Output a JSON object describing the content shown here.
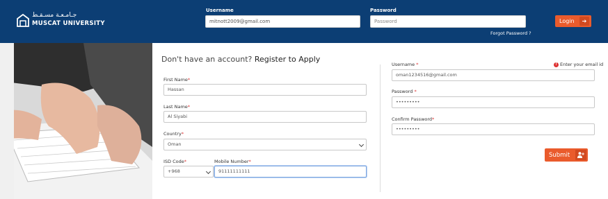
{
  "header": {
    "logo_arabic": "جـامـعـة مسـقـط",
    "logo_text": "MUSCAT UNIVERSITY",
    "username_label": "Username",
    "username_value": "mitnott2009@gmail.com",
    "password_label": "Password",
    "password_placeholder": "Password",
    "login_label": "Login",
    "forgot_label": "Forgot Password ?"
  },
  "register": {
    "heading_prefix": "Don't have an account?",
    "heading_strong": "Register to Apply",
    "first_name_label": "First Name",
    "first_name_value": "Hassan",
    "last_name_label": "Last Name",
    "last_name_value": "Al Siyabi",
    "country_label": "Country",
    "country_value": "Oman",
    "isd_label": "ISD Code",
    "isd_value": "+968",
    "mobile_label": "Mobile Number",
    "mobile_value": "91111111111",
    "required_mark": "*"
  },
  "account": {
    "username_label": "Username",
    "username_hint": "Enter your email id",
    "username_value": "oman1234516@gmail.com",
    "password_label": "Password",
    "password_value": "•••••••••",
    "confirm_label": "Confirm Password",
    "confirm_value": "•••••••••",
    "submit_label": "Submit"
  },
  "icons": {
    "login": "sign-in-icon",
    "submit": "user-plus-icon",
    "hint": "exclamation-circle-icon"
  },
  "colors": {
    "header_bg": "#0c3e74",
    "accent": "#ea5b2c",
    "required": "#dd3333"
  }
}
